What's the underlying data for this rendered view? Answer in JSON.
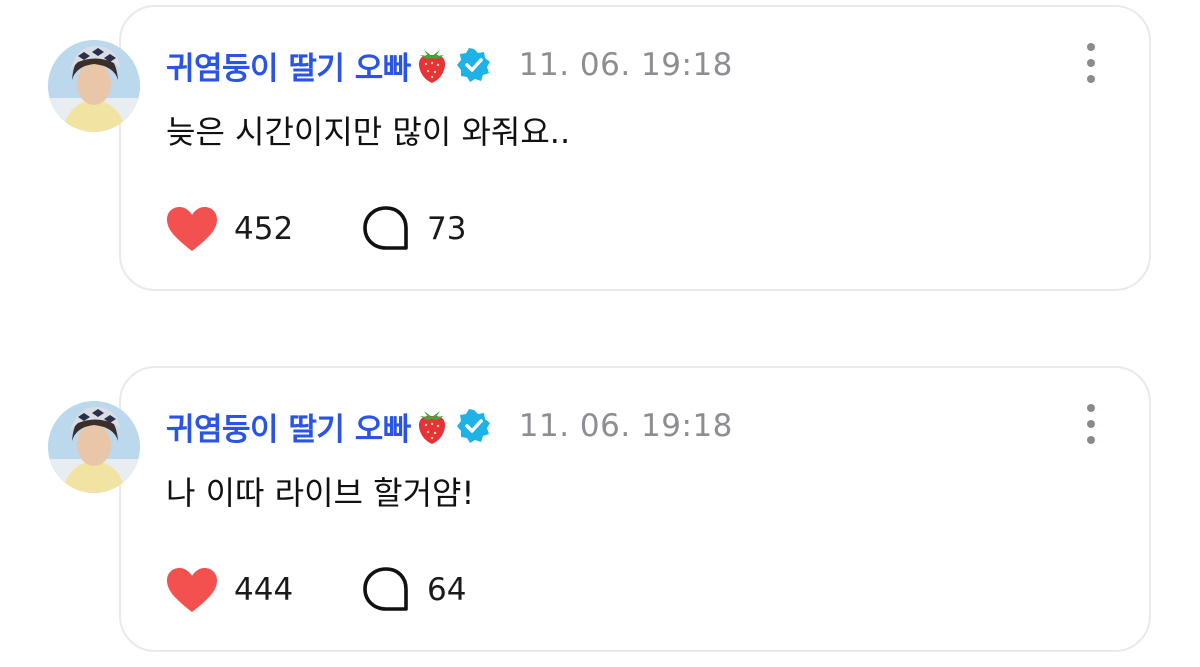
{
  "posts": [
    {
      "author": "귀염둥이 딸기 오빠",
      "timestamp": "11. 06. 19:18",
      "text": "늦은 시간이지만 많이 와줘요..",
      "likes": "452",
      "comments": "73"
    },
    {
      "author": "귀염둥이 딸기 오빠",
      "timestamp": "11. 06. 19:18",
      "text": "나 이따 라이브 할거얌!",
      "likes": "444",
      "comments": "64"
    }
  ],
  "icons": {
    "author_badge": "strawberry-icon",
    "verified": "verified-icon",
    "like": "heart-icon",
    "comment": "comment-bubble-icon",
    "menu": "more-vertical-icon"
  },
  "colors": {
    "author": "#2a54e6",
    "verified_badge": "#1db3e6",
    "heart": "#f2514f",
    "timestamp": "#8d8d94",
    "card_border": "#e9e9ee"
  }
}
